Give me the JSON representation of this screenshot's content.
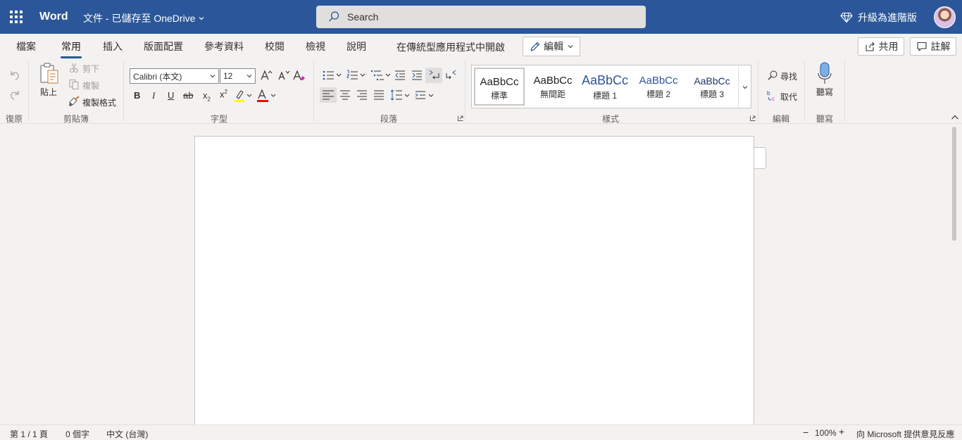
{
  "titlebar": {
    "app_name": "Word",
    "doc_title": "文件 - 已儲存至 OneDrive",
    "search_placeholder": "Search",
    "upgrade_label": "升級為進階版"
  },
  "tabs": [
    {
      "label": "檔案"
    },
    {
      "label": "常用",
      "active": true
    },
    {
      "label": "插入"
    },
    {
      "label": "版面配置"
    },
    {
      "label": "參考資料"
    },
    {
      "label": "校閱"
    },
    {
      "label": "檢視"
    },
    {
      "label": "說明"
    }
  ],
  "toolbar": {
    "open_desktop": "在傳統型應用程式中開啟",
    "edit_label": "編輯",
    "share_label": "共用",
    "comment_label": "註解"
  },
  "ribbon": {
    "undo_group": "復原",
    "clipboard": {
      "group": "剪貼簿",
      "paste": "貼上",
      "cut": "剪下",
      "copy": "複製",
      "format_painter": "複製格式"
    },
    "font": {
      "group": "字型",
      "font_name": "Calibri (本文)",
      "font_size": "12"
    },
    "paragraph": {
      "group": "段落"
    },
    "styles": {
      "group": "樣式",
      "items": [
        {
          "preview": "AaBbCc",
          "name": "標準",
          "color": "#201f1e"
        },
        {
          "preview": "AaBbCc",
          "name": "無間距",
          "color": "#201f1e"
        },
        {
          "preview": "AaBbCc",
          "name": "標題 1",
          "color": "#2f5496"
        },
        {
          "preview": "AaBbCc",
          "name": "標題 2",
          "color": "#2f5496"
        },
        {
          "preview": "AaBbCc",
          "name": "標題 3",
          "color": "#1f3763"
        }
      ]
    },
    "editing": {
      "group": "編輯",
      "find": "尋找",
      "replace": "取代"
    },
    "dictate": {
      "group": "聽寫",
      "label": "聽寫"
    }
  },
  "status": {
    "page": "第 1 / 1 頁",
    "words": "0 個字",
    "language": "中文 (台灣)",
    "zoom": "100%",
    "feedback": "向 Microsoft 提供意見反應"
  },
  "colors": {
    "brand": "#2b579a",
    "highlight": "#ffff00",
    "font_color": "#ff0000"
  }
}
